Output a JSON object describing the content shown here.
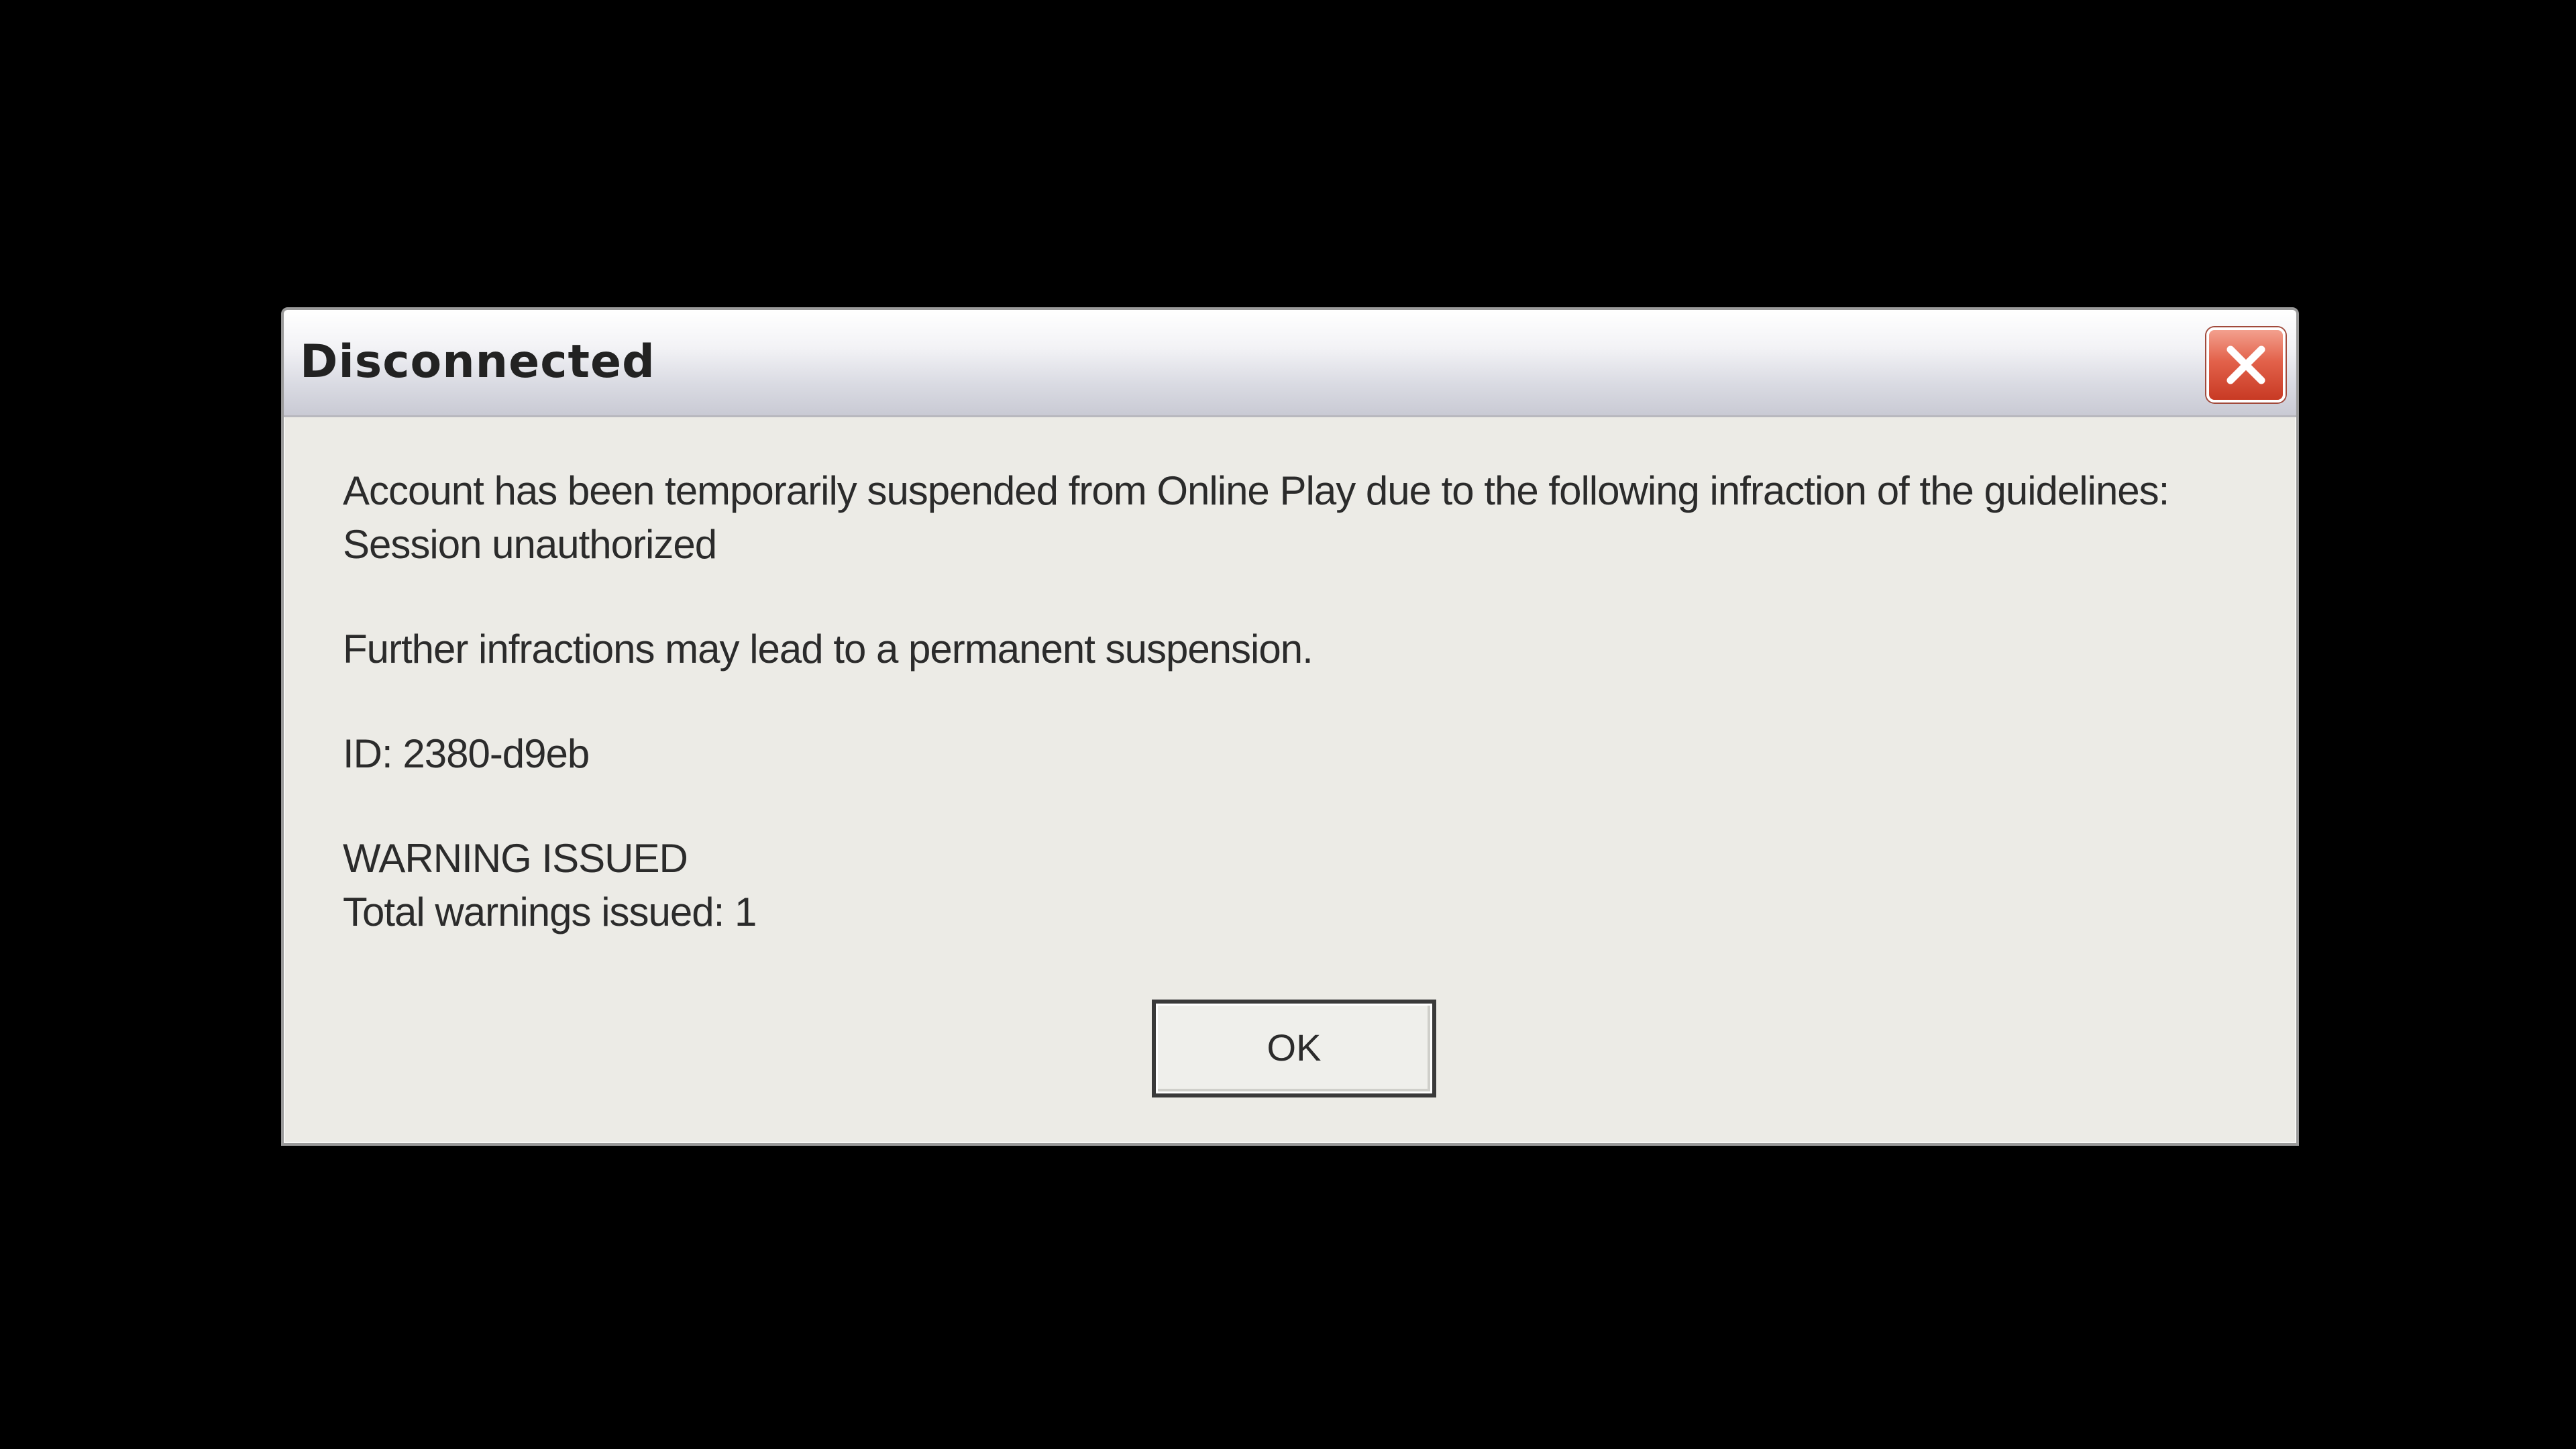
{
  "dialog": {
    "title": "Disconnected",
    "message": {
      "line1": "Account has been temporarily suspended from Online Play due to the following infraction of the guidelines:",
      "line2": "Session unauthorized",
      "line3": "Further infractions may lead to a permanent suspension.",
      "line4": "ID: 2380-d9eb",
      "line5": "WARNING ISSUED",
      "line6": "Total warnings issued: 1"
    },
    "ok_label": "OK",
    "close_icon": "close-icon"
  },
  "colors": {
    "background": "#000000",
    "dialog_body": "#ecebe6",
    "close_button": "#d9503a",
    "text": "#2b2b2b"
  }
}
